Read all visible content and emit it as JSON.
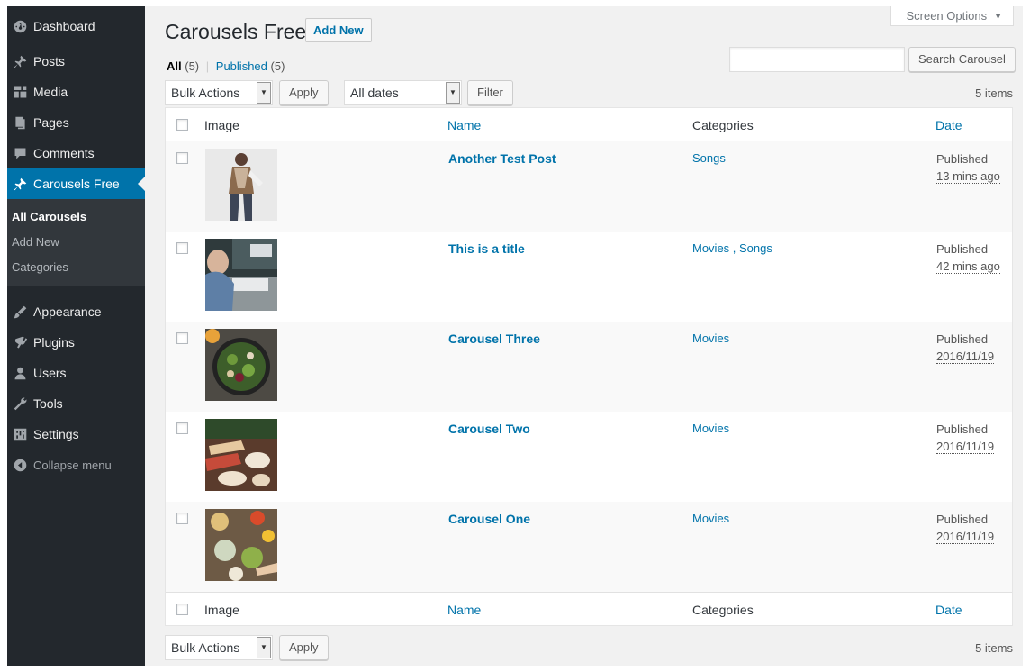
{
  "sidebar": {
    "items_top": [
      {
        "label": "Dashboard",
        "icon": "dashboard-icon"
      },
      {
        "label": "Posts",
        "icon": "pin-icon"
      },
      {
        "label": "Media",
        "icon": "media-icon"
      },
      {
        "label": "Pages",
        "icon": "pages-icon"
      },
      {
        "label": "Comments",
        "icon": "comment-icon"
      },
      {
        "label": "Carousels Free",
        "icon": "pin-icon"
      }
    ],
    "submenu": [
      {
        "label": "All Carousels"
      },
      {
        "label": "Add New"
      },
      {
        "label": "Categories"
      }
    ],
    "items_bottom": [
      {
        "label": "Appearance",
        "icon": "brush-icon"
      },
      {
        "label": "Plugins",
        "icon": "plugin-icon"
      },
      {
        "label": "Users",
        "icon": "user-icon"
      },
      {
        "label": "Tools",
        "icon": "wrench-icon"
      },
      {
        "label": "Settings",
        "icon": "settings-icon"
      },
      {
        "label": "Collapse menu",
        "icon": "collapse-icon"
      }
    ]
  },
  "header": {
    "screen_options": "Screen Options",
    "title": "Carousels Free",
    "add_new": "Add New"
  },
  "filters": {
    "all_label": "All",
    "all_count": "(5)",
    "separator": "|",
    "published_label": "Published",
    "published_count": "(5)",
    "search_button": "Search Carousel",
    "bulk_actions": "Bulk Actions",
    "apply": "Apply",
    "all_dates": "All dates",
    "filter": "Filter",
    "items_count": "5 items"
  },
  "table": {
    "columns": {
      "image": "Image",
      "name": "Name",
      "categories": "Categories",
      "date": "Date"
    },
    "rows": [
      {
        "title": "Another Test Post",
        "categories": "Songs",
        "status": "Published",
        "date": "13 mins ago"
      },
      {
        "title": "This is a title",
        "categories": "Movies , Songs",
        "status": "Published",
        "date": "42 mins ago"
      },
      {
        "title": "Carousel Three",
        "categories": "Movies",
        "status": "Published",
        "date": "2016/11/19"
      },
      {
        "title": "Carousel Two",
        "categories": "Movies",
        "status": "Published",
        "date": "2016/11/19"
      },
      {
        "title": "Carousel One",
        "categories": "Movies",
        "status": "Published",
        "date": "2016/11/19"
      }
    ]
  },
  "colors": {
    "sidebar_bg": "#23282d",
    "accent": "#0073aa",
    "content_bg": "#f1f1f1"
  }
}
